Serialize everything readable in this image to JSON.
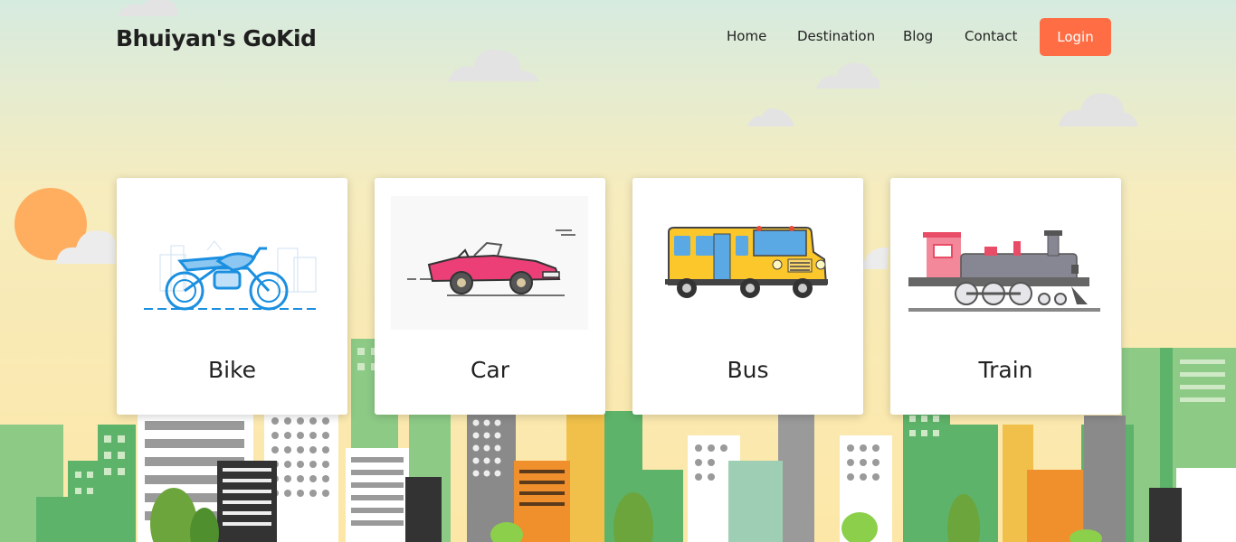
{
  "header": {
    "brand": "Bhuiyan's GoKid",
    "nav": [
      "Home",
      "Destination",
      "Blog",
      "Contact"
    ],
    "login_label": "Login"
  },
  "cards": [
    {
      "label": "Bike",
      "icon": "bike-icon"
    },
    {
      "label": "Car",
      "icon": "car-icon"
    },
    {
      "label": "Bus",
      "icon": "bus-icon"
    },
    {
      "label": "Train",
      "icon": "train-icon"
    }
  ],
  "colors": {
    "accent": "#ff6d45",
    "sky_top": "#d6ebe0",
    "sky_bottom": "#fde8a6",
    "sun": "#ffae5f",
    "building_green": "#5eb36a"
  }
}
